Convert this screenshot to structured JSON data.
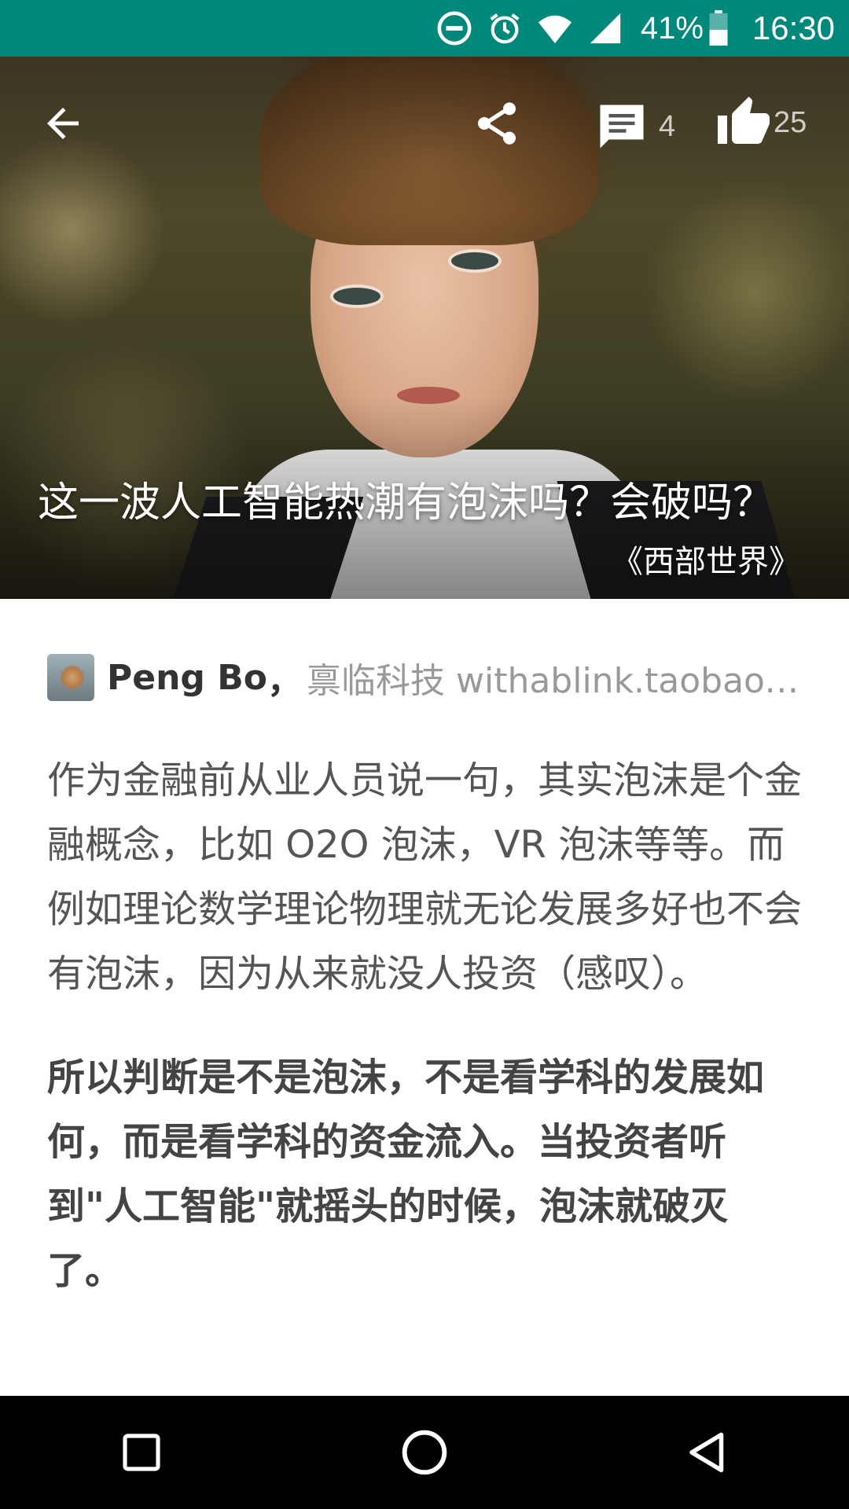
{
  "status_bar": {
    "battery_percent": "41%",
    "time": "16:30",
    "icons": [
      "do-not-disturb-icon",
      "alarm-icon",
      "wifi-icon",
      "cell-signal-icon",
      "battery-icon"
    ]
  },
  "toolbar": {
    "back_icon": "back-arrow-icon",
    "share_icon": "share-icon",
    "comment_icon": "comment-icon",
    "comment_count": "4",
    "like_icon": "thumbs-up-icon",
    "like_count": "25"
  },
  "hero": {
    "title": "这一波人工智能热潮有泡沫吗？会破吗？",
    "caption": "《西部世界》"
  },
  "author": {
    "name": "Peng Bo",
    "separator": "，",
    "bio": "禀临科技 withablink.taobao.com"
  },
  "article": {
    "paragraphs": [
      "作为金融前从业人员说一句，其实泡沫是个金融概念，比如 O2O 泡沫，VR 泡沫等等。而例如理论数学理论物理就无论发展多好也不会有泡沫，因为从来就没人投资（感叹）。",
      "所以判断是不是泡沫，不是看学科的发展如何，而是看学科的资金流入。当投资者听到\"人工智能\"就摇头的时候，泡沫就破灭了。"
    ]
  },
  "nav_bar": {
    "icons": [
      "recents-icon",
      "home-icon",
      "back-icon"
    ]
  },
  "colors": {
    "status_bar": "#00897b",
    "nav_bar": "#000000"
  }
}
